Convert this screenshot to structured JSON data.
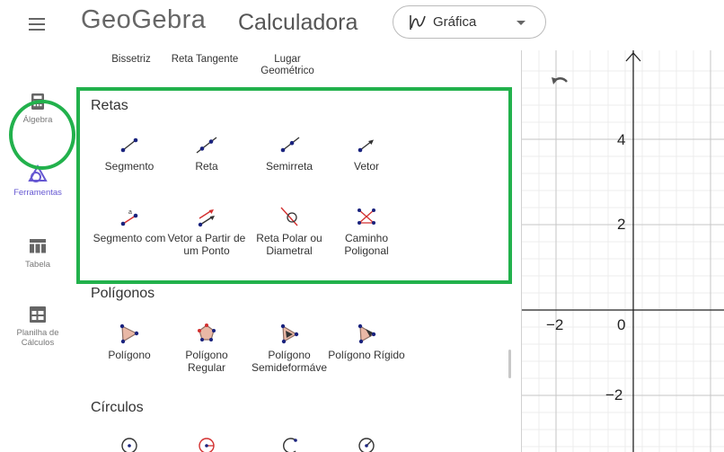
{
  "header": {
    "logo_text": "GeoGebra",
    "app_title": "Calculadora",
    "perspective_label": "Gráfica"
  },
  "dock": {
    "items": [
      {
        "label": "Álgebra",
        "icon": "calculator-icon"
      },
      {
        "label": "Ferramentas",
        "icon": "shapes-icon",
        "active": true
      },
      {
        "label": "Tabela",
        "icon": "table-icon"
      },
      {
        "label": "Planilha de Cálculos",
        "icon": "spreadsheet-icon"
      }
    ]
  },
  "tools": {
    "top_row": [
      "Bissetriz",
      "Reta Tangente",
      "Lugar Geométrico"
    ],
    "categories": [
      {
        "title": "Retas",
        "items": [
          "Segmento",
          "Reta",
          "Semirreta",
          "Vetor",
          "Segmento com",
          "Vetor a Partir de um Ponto",
          "Reta Polar ou Diametral",
          "Caminho Poligonal"
        ]
      },
      {
        "title": "Polígonos",
        "items": [
          "Polígono",
          "Polígono Regular",
          "Polígono Semideformáve",
          "Polígono Rígido"
        ]
      },
      {
        "title": "Círculos",
        "items": []
      }
    ]
  },
  "graphics": {
    "x_ticks": [
      "−2",
      "0"
    ],
    "y_ticks": [
      "4",
      "2",
      "−2"
    ]
  },
  "colors": {
    "highlight": "#22b14c",
    "accent": "#6557d2",
    "point_blue": "#1a237e",
    "point_red": "#d32f2f"
  }
}
